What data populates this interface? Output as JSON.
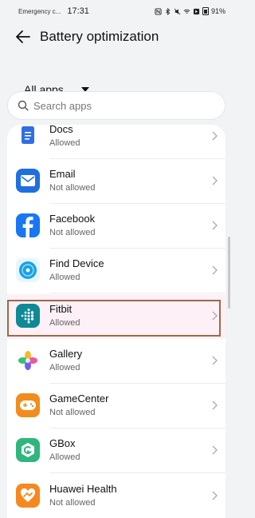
{
  "status_bar": {
    "carrier": "Emergency c...",
    "time": "17:31",
    "battery": "91%"
  },
  "header": {
    "title": "Battery optimization"
  },
  "filter": {
    "label": "All apps"
  },
  "search": {
    "placeholder": "Search apps"
  },
  "apps": [
    {
      "name": "Docs",
      "status": "Allowed",
      "icon": "docs-icon",
      "color": "#2f6fe6"
    },
    {
      "name": "Email",
      "status": "Not allowed",
      "icon": "email-icon",
      "color": "#1f6fe0"
    },
    {
      "name": "Facebook",
      "status": "Not allowed",
      "icon": "facebook-icon",
      "color": "#1877f2"
    },
    {
      "name": "Find Device",
      "status": "Allowed",
      "icon": "find-device-icon",
      "color": "#1aa0e8"
    },
    {
      "name": "Fitbit",
      "status": "Allowed",
      "icon": "fitbit-icon",
      "color": "#0e8a97"
    },
    {
      "name": "Gallery",
      "status": "Allowed",
      "icon": "gallery-icon",
      "color": "#e85aa0"
    },
    {
      "name": "GameCenter",
      "status": "Not allowed",
      "icon": "gamecenter-icon",
      "color": "#f28c1c"
    },
    {
      "name": "GBox",
      "status": "Allowed",
      "icon": "gbox-icon",
      "color": "#2fb67c"
    },
    {
      "name": "Huawei Health",
      "status": "Not allowed",
      "icon": "huawei-health-icon",
      "color": "#f5891f"
    }
  ],
  "highlighted_app": "Fitbit"
}
